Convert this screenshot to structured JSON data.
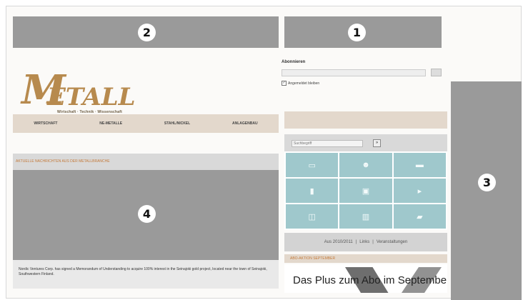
{
  "markers": {
    "region_1": "1",
    "region_2": "2",
    "region_3": "3",
    "region_4": "4"
  },
  "subscribe": {
    "label": "Abonnieren",
    "checkbox_label": "Angemeldet bleiben"
  },
  "logo": {
    "first_letter": "M",
    "rest": "ETALL",
    "tagline": "Wirtschaft · Technik · Wissenschaft"
  },
  "nav": {
    "items": [
      "WIRTSCHAFT",
      "NE-METALLE",
      "STAHL/NICKEL",
      "ANLAGENBAU"
    ]
  },
  "main": {
    "section_title": "AKTUELLE NACHRICHTEN AUS DER METALLBRANCHE",
    "caption": "Nordic Ventures Corp. has signed a Memorandum of Understanding to acquire 100% interest in the Seinajoki gold project, located near the town of Seinajoki, Southwestern Finland."
  },
  "sidebar": {
    "search_placeholder": "Suchbegriff",
    "search_button": "»",
    "grid_icons": [
      "monitor-icon",
      "people-icon",
      "laptop-icon",
      "book-icon",
      "calendar-icon",
      "truck-icon",
      "factory-icon",
      "chart-icon",
      "folder-icon"
    ],
    "links": [
      "Aus 2010/2011",
      "Links",
      "Veranstaltungen"
    ],
    "link_separator": "|",
    "label": "ABO-AKTION SEPTEMBER",
    "promo_text": "Das Plus zum Abo im September"
  }
}
